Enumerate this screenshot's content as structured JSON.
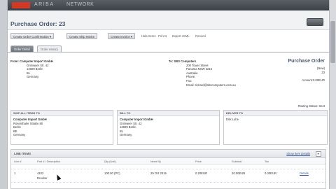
{
  "brand": {
    "name": "ARIBA",
    "network": "NETWORK"
  },
  "header": {
    "title": "Purchase Order: 23",
    "done_icon": "done-button"
  },
  "toolbar": {
    "create_order_confirmation": "Create Order Confirmation ▾",
    "create_ship_notice": "Create Ship Notice",
    "create_invoice": "Create Invoice ▾",
    "hide_items": "Hide Items",
    "print": "Print ▾",
    "export_cxml": "Export cXML",
    "resend": "Resend"
  },
  "tabs": [
    "Order Detail",
    "Order History"
  ],
  "from": {
    "label": "From:",
    "company": "Computer Import GmbH",
    "lines": [
      "Grimweer Str. 42",
      "12609 Berlin",
      "BL",
      "Germany"
    ]
  },
  "to": {
    "label": "To:",
    "company": "SBS Computers",
    "lines": [
      "200 Tower Street",
      "Panama NSW 2215",
      "Australia",
      "Phone:",
      "Fax:",
      "Email: richard@sbscomputers.com.au"
    ]
  },
  "purchase_order": {
    "label": "Purchase Order",
    "status": "(New)",
    "number": "23",
    "amount": "Amount:0.00EUR"
  },
  "routing_status": "Routing Status:  Sent",
  "ship_all_items_to": {
    "title": "SHIP ALL ITEMS TO",
    "company": "Computer Import GmbH",
    "lines": [
      "Rosenthaler Straße 80",
      "Berlin",
      "BE",
      "Germany"
    ]
  },
  "bill_to": {
    "title": "BILL TO",
    "company": "Computer Import GmbH",
    "lines": [
      "Grimweer Str. 42",
      "12609 Berlin",
      "BL",
      "Germany"
    ]
  },
  "deliver_to": {
    "title": "DELIVER TO",
    "name": "Dirk Luhe"
  },
  "line_items": {
    "title": "LINE ITEMS",
    "show_details": "Show Item Details",
    "columns": [
      "Line #",
      "Part # / Description",
      "Qty (Unit)",
      "Need By",
      "Price",
      "Subtotal",
      "Tax",
      ""
    ],
    "rows": [
      {
        "line": "1",
        "part": "4102",
        "description": "Drucker",
        "qty": "100.00 (PC)",
        "need_by": "29 Oct 2015",
        "price": "0.20EUR",
        "subtotal": "20.00EUR",
        "tax": "0.00EUR",
        "details": "Details"
      }
    ]
  }
}
